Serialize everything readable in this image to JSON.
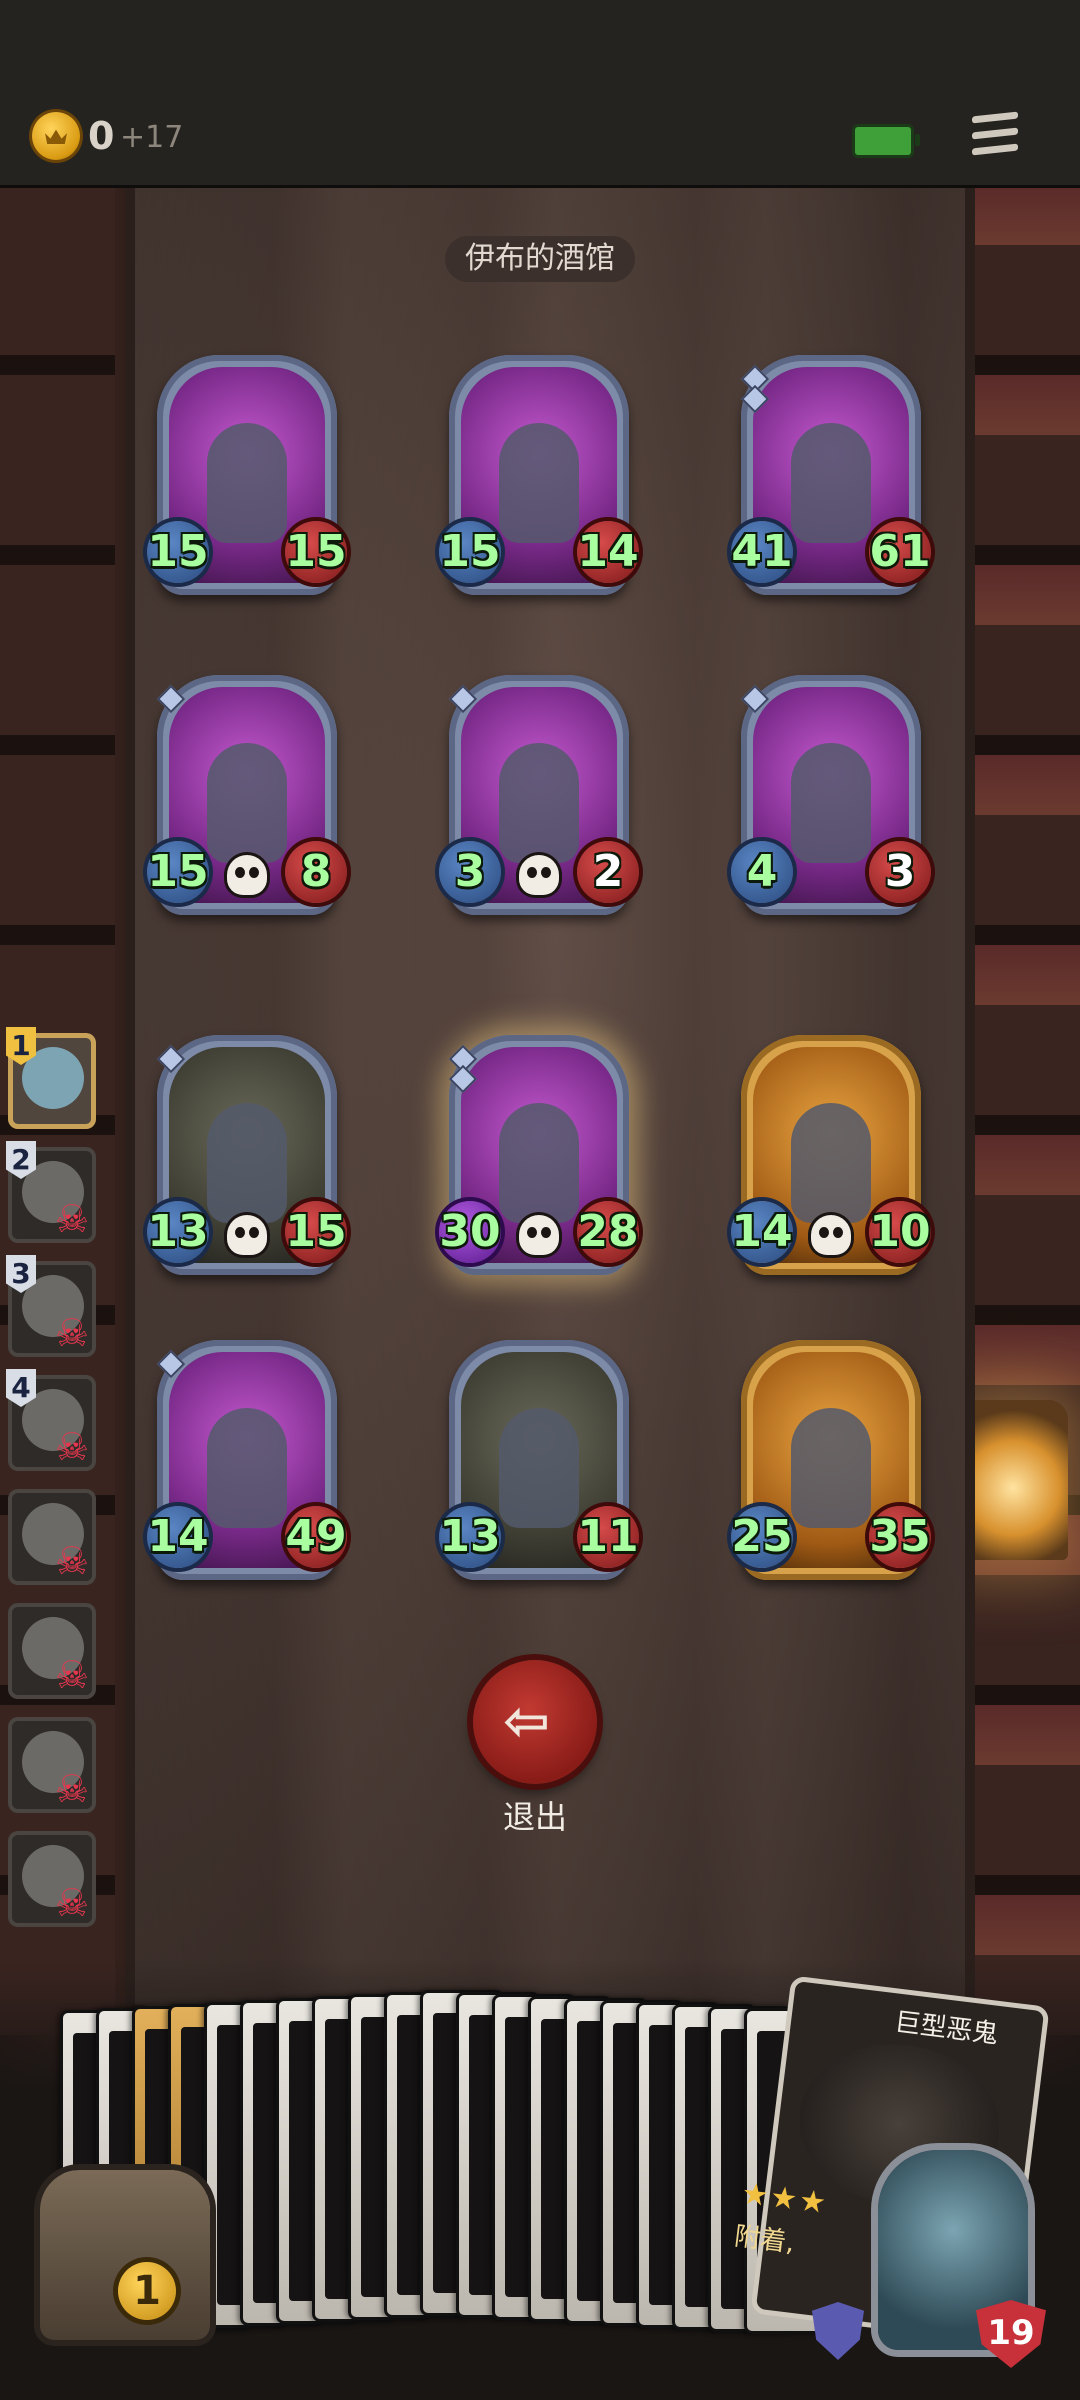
{
  "header": {
    "gold": "0",
    "gold_income": "+17"
  },
  "tavern": {
    "title": "伊布的酒馆"
  },
  "minions": [
    {
      "attack": "15",
      "health": "15",
      "frame": "silver",
      "art": "purple",
      "gems": 0,
      "skull": false
    },
    {
      "attack": "15",
      "health": "14",
      "frame": "silver",
      "art": "purple",
      "gems": 0,
      "skull": false
    },
    {
      "attack": "41",
      "health": "61",
      "frame": "silver",
      "art": "purple",
      "gems": 2,
      "skull": false
    },
    {
      "attack": "15",
      "health": "8",
      "frame": "silver",
      "art": "purple",
      "gems": 1,
      "skull": true
    },
    {
      "attack": "3",
      "health": "2",
      "frame": "silver",
      "art": "purple",
      "gems": 1,
      "skull": true
    },
    {
      "attack": "4",
      "health": "3",
      "frame": "silver",
      "art": "purple",
      "gems": 1,
      "skull": false
    },
    {
      "attack": "13",
      "health": "15",
      "frame": "silver",
      "art": "dark",
      "gems": 1,
      "skull": true
    },
    {
      "attack": "30",
      "health": "28",
      "frame": "silver",
      "art": "purple",
      "gems": 2,
      "skull": true
    },
    {
      "attack": "14",
      "health": "10",
      "frame": "gold",
      "art": "orange",
      "gems": 0,
      "skull": true
    },
    {
      "attack": "14",
      "health": "49",
      "frame": "silver",
      "art": "purple",
      "gems": 1,
      "skull": false
    },
    {
      "attack": "13",
      "health": "11",
      "frame": "silver",
      "art": "dark",
      "gems": 0,
      "skull": false
    },
    {
      "attack": "25",
      "health": "35",
      "frame": "gold",
      "art": "orange",
      "gems": 0,
      "skull": false
    }
  ],
  "exit": {
    "label": "退出"
  },
  "opponents": [
    {
      "rank": "1",
      "current": true
    },
    {
      "rank": "2",
      "current": false
    },
    {
      "rank": "3",
      "current": false
    },
    {
      "rank": "4",
      "current": false
    },
    {
      "rank": "",
      "current": false
    },
    {
      "rank": "",
      "current": false
    },
    {
      "rank": "",
      "current": false
    },
    {
      "rank": "",
      "current": false
    }
  ],
  "hand": {
    "card_count": 20,
    "featured_name": "巨型恶鬼",
    "featured_text": "附着,",
    "featured_stars": 3
  },
  "chest": {
    "level": "1"
  },
  "hero": {
    "health": "19"
  },
  "colors": {
    "stat_text": "#a9ff9f",
    "attack_gem": "#2a4a7e",
    "health_gem": "#7e1a1a",
    "exit_button": "#c23a32",
    "gold_coin": "#ffd45a"
  }
}
